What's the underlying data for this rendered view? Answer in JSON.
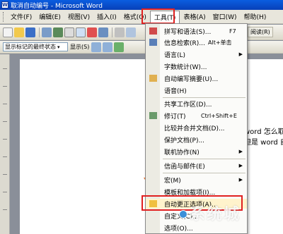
{
  "window": {
    "title": "取消自动编号 - Microsoft Word"
  },
  "menubar": {
    "items": [
      "文件(F)",
      "编辑(E)",
      "视图(V)",
      "插入(I)",
      "格式(O)",
      "工具(T)",
      "表格(A)",
      "窗口(W)",
      "帮助(H)"
    ],
    "active_index": 5
  },
  "toolbar": {
    "read_button": "阅读(R)",
    "markup_combo": "显示标记的最终状态",
    "show_label": "显示(S)"
  },
  "tools_menu": {
    "items": [
      {
        "label": "拼写和语法(S)...",
        "shortcut": "F7"
      },
      {
        "label": "信息检索(R)...",
        "shortcut": "Alt+单击"
      },
      {
        "label": "语言(L)",
        "submenu": true
      },
      {
        "label": "字数统计(W)..."
      },
      {
        "label": "自动编写摘要(U)..."
      },
      {
        "label": "语音(H)"
      },
      {
        "label": "共享工作区(D)..."
      },
      {
        "label": "修订(T)",
        "shortcut": "Ctrl+Shift+E"
      },
      {
        "label": "比较并合并文档(D)..."
      },
      {
        "label": "保护文档(P)..."
      },
      {
        "label": "联机协作(N)",
        "submenu": true
      },
      {
        "label": "信函与邮件(E)",
        "submenu": true
      },
      {
        "label": "宏(M)",
        "submenu": true
      },
      {
        "label": "模板和加载项(I)..."
      },
      {
        "label": "自动更正选项(A)..."
      },
      {
        "label": "自定义(C)..."
      },
      {
        "label": "选项(O)..."
      }
    ]
  },
  "document": {
    "line1": "word 怎么取",
    "line2": "但是 word 自"
  },
  "watermark": {
    "text": "系统城"
  },
  "colors": {
    "highlight_box": "#e02020",
    "title_bar": "#0a5de0"
  }
}
